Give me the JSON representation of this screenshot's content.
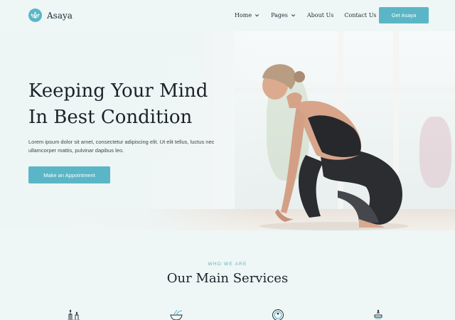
{
  "brand": {
    "name": "Asaya",
    "accent": "#5ab6c6",
    "icon": "lotus-icon"
  },
  "nav": {
    "items": [
      {
        "label": "Home",
        "has_dropdown": true
      },
      {
        "label": "Pages",
        "has_dropdown": true
      },
      {
        "label": "About Us",
        "has_dropdown": false
      },
      {
        "label": "Contact Us",
        "has_dropdown": false
      }
    ],
    "cta_label": "Get Asaya"
  },
  "hero": {
    "title_line1": "Keeping Your Mind",
    "title_line2": "In Best Condition",
    "text": "Lorem ipsum dolor sit amet, consectetur adipiscing elit. Ut elit tellus, luctus nec ullamcorper mattis, pulvinar dapibus leo.",
    "button_label": "Make an Appointment",
    "image": "woman-stretching-photo"
  },
  "services": {
    "eyebrow": "WHO WE ARE",
    "title": "Our Main Services",
    "icons": [
      "candles-icon",
      "herbs-bowl-icon",
      "meditation-icon",
      "spa-stones-icon"
    ]
  }
}
